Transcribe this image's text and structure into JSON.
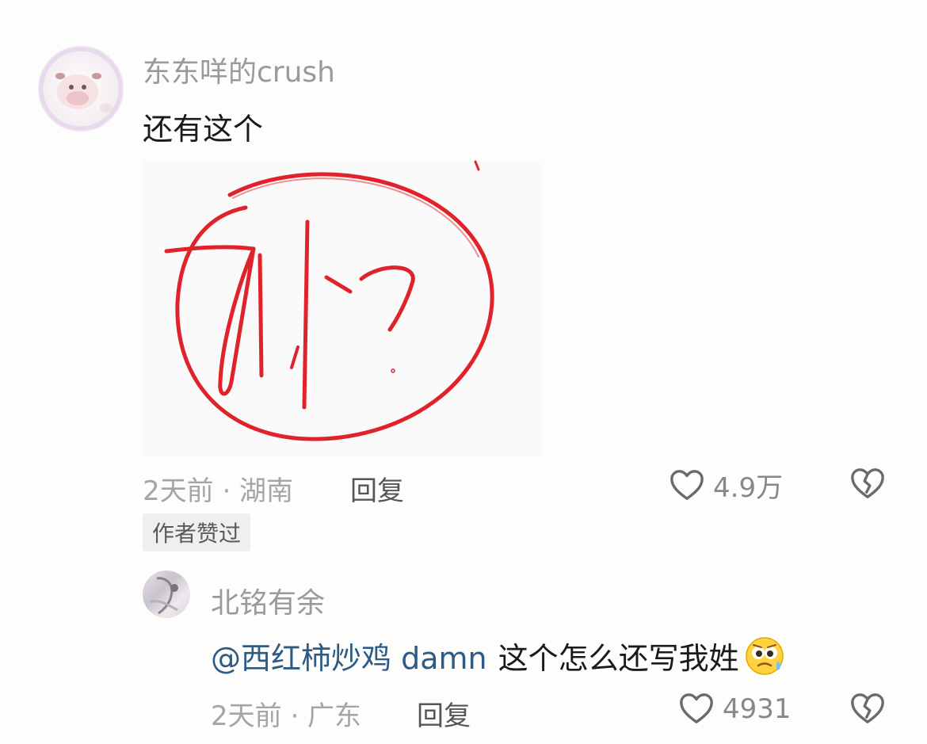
{
  "comment": {
    "username": "东东咩的crush",
    "text": "还有这个",
    "meta": "2天前 · 湖南",
    "reply_label": "回复",
    "likes": "4.9万",
    "badge": "作者赞过"
  },
  "reply": {
    "username": "北铭有余",
    "mention": "@西红柿炒鸡 damn",
    "text": "这个怎么还写我姓",
    "emoji": "anxious-face-icon",
    "meta": "2天前 · 广东",
    "reply_label": "回复",
    "likes": "4931"
  },
  "colors": {
    "mention": "#2d5b85",
    "signature_red": "#e0232b"
  }
}
